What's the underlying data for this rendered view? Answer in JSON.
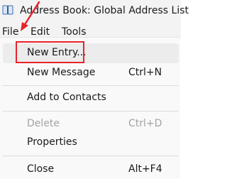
{
  "window": {
    "title": "Address Book: Global Address List",
    "icon": "address-book-icon"
  },
  "menubar": {
    "items": [
      {
        "label": "File"
      },
      {
        "label": "Edit"
      },
      {
        "label": "Tools"
      }
    ]
  },
  "file_menu": {
    "items": [
      {
        "label": "New Entry...",
        "shortcut": "",
        "state": "highlighted"
      },
      {
        "label": "New Message",
        "shortcut": "Ctrl+N",
        "state": "enabled"
      },
      {
        "label": "Add to Contacts",
        "shortcut": "",
        "state": "enabled"
      },
      {
        "label": "Delete",
        "shortcut": "Ctrl+D",
        "state": "disabled"
      },
      {
        "label": "Properties",
        "shortcut": "",
        "state": "enabled"
      },
      {
        "label": "Close",
        "shortcut": "Alt+F4",
        "state": "enabled"
      }
    ]
  },
  "annotation": {
    "color": "#e8242b",
    "target": "New Entry..."
  }
}
